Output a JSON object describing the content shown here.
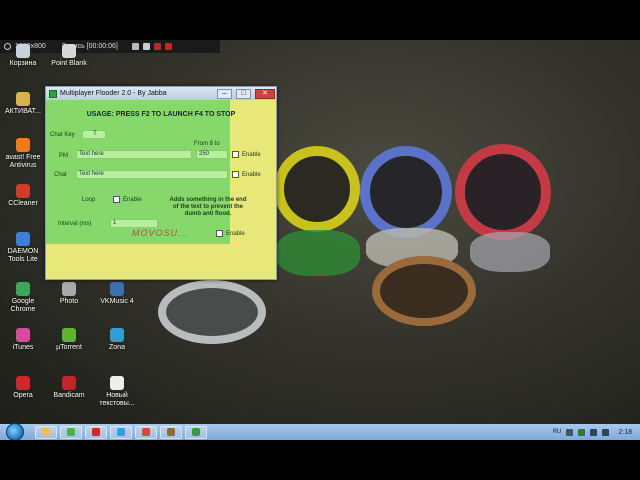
{
  "recorder": {
    "resolution": "1280x800",
    "recording_label": "Запись [00:00:06]"
  },
  "desktop_icons": [
    {
      "label": "Корзина",
      "icon": "recycle-bin-icon",
      "color": "#c8d2dc"
    },
    {
      "label": "Point Blank",
      "icon": "game-icon",
      "color": "#d7d7d7"
    },
    {
      "label": "АКТИВАТ...",
      "icon": "folder-icon",
      "color": "#d8b24a"
    },
    {
      "label": "avast! Free Antivirus",
      "icon": "avast-icon",
      "color": "#ef7b1a"
    },
    {
      "label": "CCleaner",
      "icon": "ccleaner-icon",
      "color": "#d23a2a"
    },
    {
      "label": "DAEMON Tools Lite",
      "icon": "daemon-tools-icon",
      "color": "#3d7fd6"
    },
    {
      "label": "Google Chrome",
      "icon": "chrome-icon",
      "color": "#3ba55c"
    },
    {
      "label": "iTunes",
      "icon": "itunes-icon",
      "color": "#d94a9a"
    },
    {
      "label": "Opera",
      "icon": "opera-icon",
      "color": "#d1262c"
    },
    {
      "label": "Photo",
      "icon": "photo-icon",
      "color": "#aaa"
    },
    {
      "label": "VKMusic 4",
      "icon": "vkmusic-icon",
      "color": "#3a6fb0"
    },
    {
      "label": "µTorrent",
      "icon": "utorrent-icon",
      "color": "#62b32e"
    },
    {
      "label": "Zona",
      "icon": "zona-icon",
      "color": "#2e9ed8"
    },
    {
      "label": "Bandicam",
      "icon": "bandicam-icon",
      "color": "#c2242a"
    },
    {
      "label": "Новый текстовы...",
      "icon": "text-file-icon",
      "color": "#eee"
    }
  ],
  "window": {
    "title": "Multiplayer Flooder 2.0 - By Jabba",
    "usage": "USAGE: PRESS F2 TO LAUNCH F4 TO STOP",
    "chat_key_label": "Chat Key",
    "chat_key_value": "T",
    "from_label": "From 8 to",
    "pm_label": "PM",
    "pm_value": "Text here",
    "pm_number": "250",
    "enable_label": "Enable",
    "chat_label": "Chat",
    "chat_value": "Text here",
    "loop_label": "Loop",
    "note": "Adds something in the end of the text to prevent the dumb anti flood.",
    "interval_label": "Interval (ms)",
    "interval_value": "1",
    "watermark": "MOVOSU..."
  },
  "taskbar": {
    "items": [
      {
        "icon": "explorer-icon",
        "color": "#e8c24a"
      },
      {
        "icon": "chrome-icon",
        "color": "#4caf50"
      },
      {
        "icon": "opera-icon",
        "color": "#d1262c"
      },
      {
        "icon": "skype-icon",
        "color": "#2aa3e0"
      },
      {
        "icon": "gmail-icon",
        "color": "#d9483b"
      },
      {
        "icon": "game-icon",
        "color": "#8a6b3a"
      },
      {
        "icon": "flooder-icon",
        "color": "#2ea043"
      }
    ],
    "tray_lang": "RU",
    "clock": "2:18"
  }
}
